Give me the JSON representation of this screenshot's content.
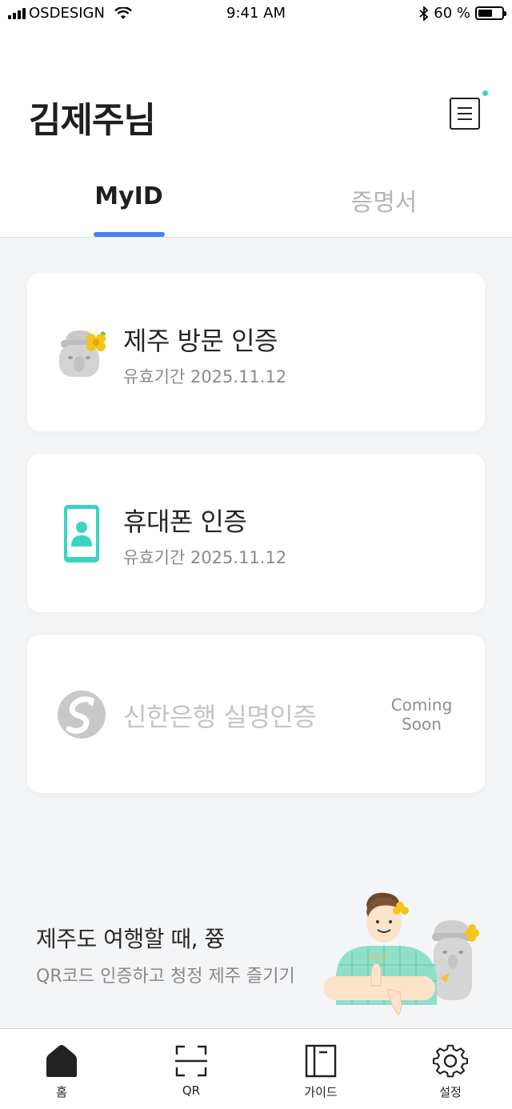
{
  "status_bar": {
    "carrier": "OSDESIGN",
    "time": "9:41 AM",
    "battery_text": "60 %",
    "battery_level": 0.6
  },
  "header": {
    "title": "김제주님",
    "menu_icon": "menu-list-icon",
    "notification_dot_color": "#33d6c5"
  },
  "tabs": [
    {
      "label": "MyID",
      "active": true
    },
    {
      "label": "증명서",
      "active": false
    }
  ],
  "accent_color": "#4a7ef0",
  "cards": [
    {
      "title": "제주 방문 인증",
      "subtitle": "유효기간 2025.11.12",
      "icon": "jeju-stone-statue-icon"
    },
    {
      "title": "휴대폰 인증",
      "subtitle": "유효기간 2025.11.12",
      "icon": "phone-user-icon",
      "icon_color": "#3cd3c1"
    },
    {
      "title": "신한은행 실명인증",
      "badge": "Coming Soon",
      "icon": "shinhan-logo-icon",
      "disabled": true
    }
  ],
  "promo": {
    "title": "제주도 여행할 때, 쯍",
    "subtitle": "QR코드 인증하고 청정 제주 즐기기"
  },
  "bottom_nav": [
    {
      "label": "홈",
      "icon": "home-icon"
    },
    {
      "label": "QR",
      "icon": "qr-scan-icon"
    },
    {
      "label": "가이드",
      "icon": "guide-book-icon"
    },
    {
      "label": "설정",
      "icon": "settings-gear-icon"
    }
  ]
}
